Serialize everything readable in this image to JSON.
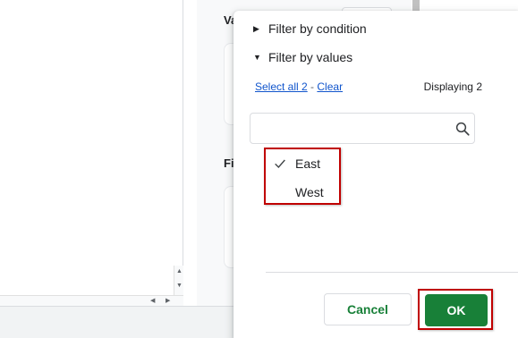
{
  "side_panel": {
    "label_values_partial": "Va",
    "label_filter_partial": "Fi"
  },
  "filter_popup": {
    "filter_by_condition": "Filter by condition",
    "filter_by_values": "Filter by values",
    "select_all": "Select all 2",
    "separator": "-",
    "clear": "Clear",
    "displaying": "Displaying 2",
    "search": {
      "value": "",
      "placeholder": ""
    },
    "values": [
      {
        "label": "East",
        "checked": true
      },
      {
        "label": "West",
        "checked": false
      }
    ],
    "cancel_label": "Cancel",
    "ok_label": "OK"
  },
  "colors": {
    "accent_green": "#188038",
    "link_blue": "#1155cc",
    "highlight_red": "#c00000"
  },
  "icons": [
    "caret-right-icon",
    "caret-down-icon",
    "search-icon",
    "checkmark-icon",
    "scroll-arrow-icon"
  ]
}
